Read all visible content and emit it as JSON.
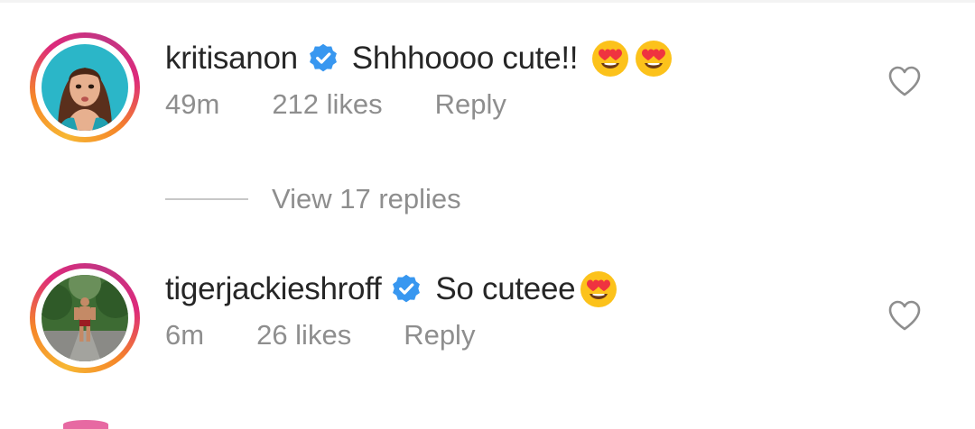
{
  "comments": [
    {
      "username": "kritisanon",
      "verified": true,
      "text": "Shhhoooo cute!!",
      "emoji": [
        "heart-eyes",
        "heart-eyes"
      ],
      "time": "49m",
      "likes": "212 likes",
      "reply_label": "Reply",
      "view_replies": "View 17 replies"
    },
    {
      "username": "tigerjackieshroff",
      "verified": true,
      "text": "So cuteee",
      "emoji": [
        "heart-eyes"
      ],
      "time": "6m",
      "likes": "26 likes",
      "reply_label": "Reply"
    }
  ],
  "colors": {
    "verified_blue": "#3897f0",
    "muted_text": "#8e8e8e",
    "primary_text": "#262626"
  }
}
